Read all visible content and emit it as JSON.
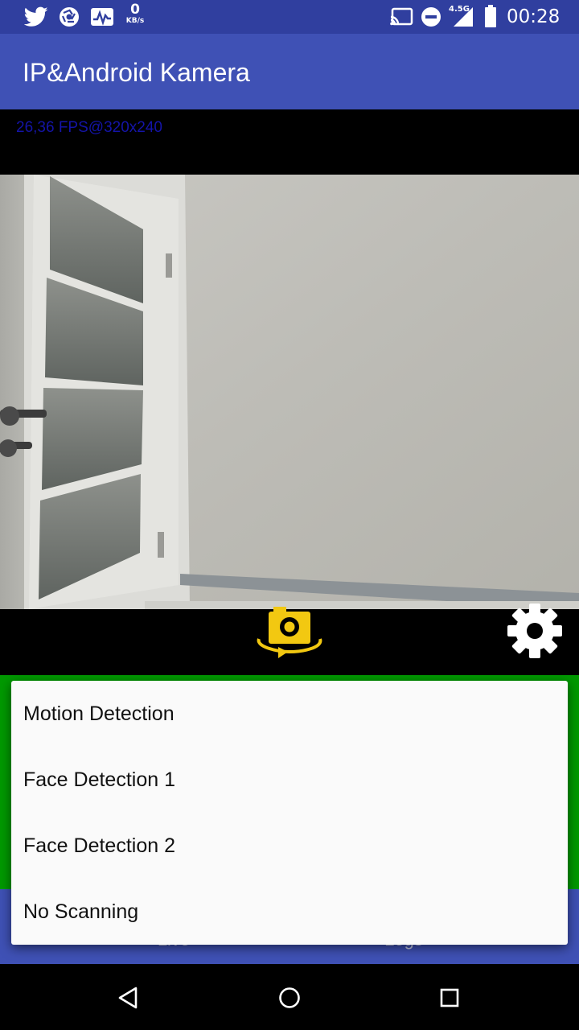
{
  "status_bar": {
    "data_rate_value": "0",
    "data_rate_unit": "KB/s",
    "network_type": "4.5G",
    "time": "00:28",
    "icons": [
      "twitter-icon",
      "aperture-icon",
      "activity-monitor-icon",
      "cast-icon",
      "do-not-disturb-icon",
      "signal-icon",
      "battery-icon"
    ]
  },
  "app_bar": {
    "title": "IP&Android Kamera"
  },
  "camera": {
    "fps_overlay": "26,36 FPS@320x240",
    "switch_camera_icon": "switch-camera-icon",
    "settings_icon": "gear-icon",
    "accent_color": "#f2c811"
  },
  "tabs": [
    {
      "label": "Live"
    },
    {
      "label": "Logs"
    }
  ],
  "menu": {
    "items": [
      {
        "label": "Motion Detection"
      },
      {
        "label": "Face Detection 1"
      },
      {
        "label": "Face Detection 2"
      },
      {
        "label": "No Scanning"
      }
    ]
  },
  "colors": {
    "status_bar": "#303f9f",
    "app_bar": "#3f51b5",
    "panel_green": "#009900",
    "fps_text": "#1414a8"
  },
  "nav_bar": {
    "icons": [
      "back-icon",
      "home-icon",
      "recents-icon"
    ]
  }
}
